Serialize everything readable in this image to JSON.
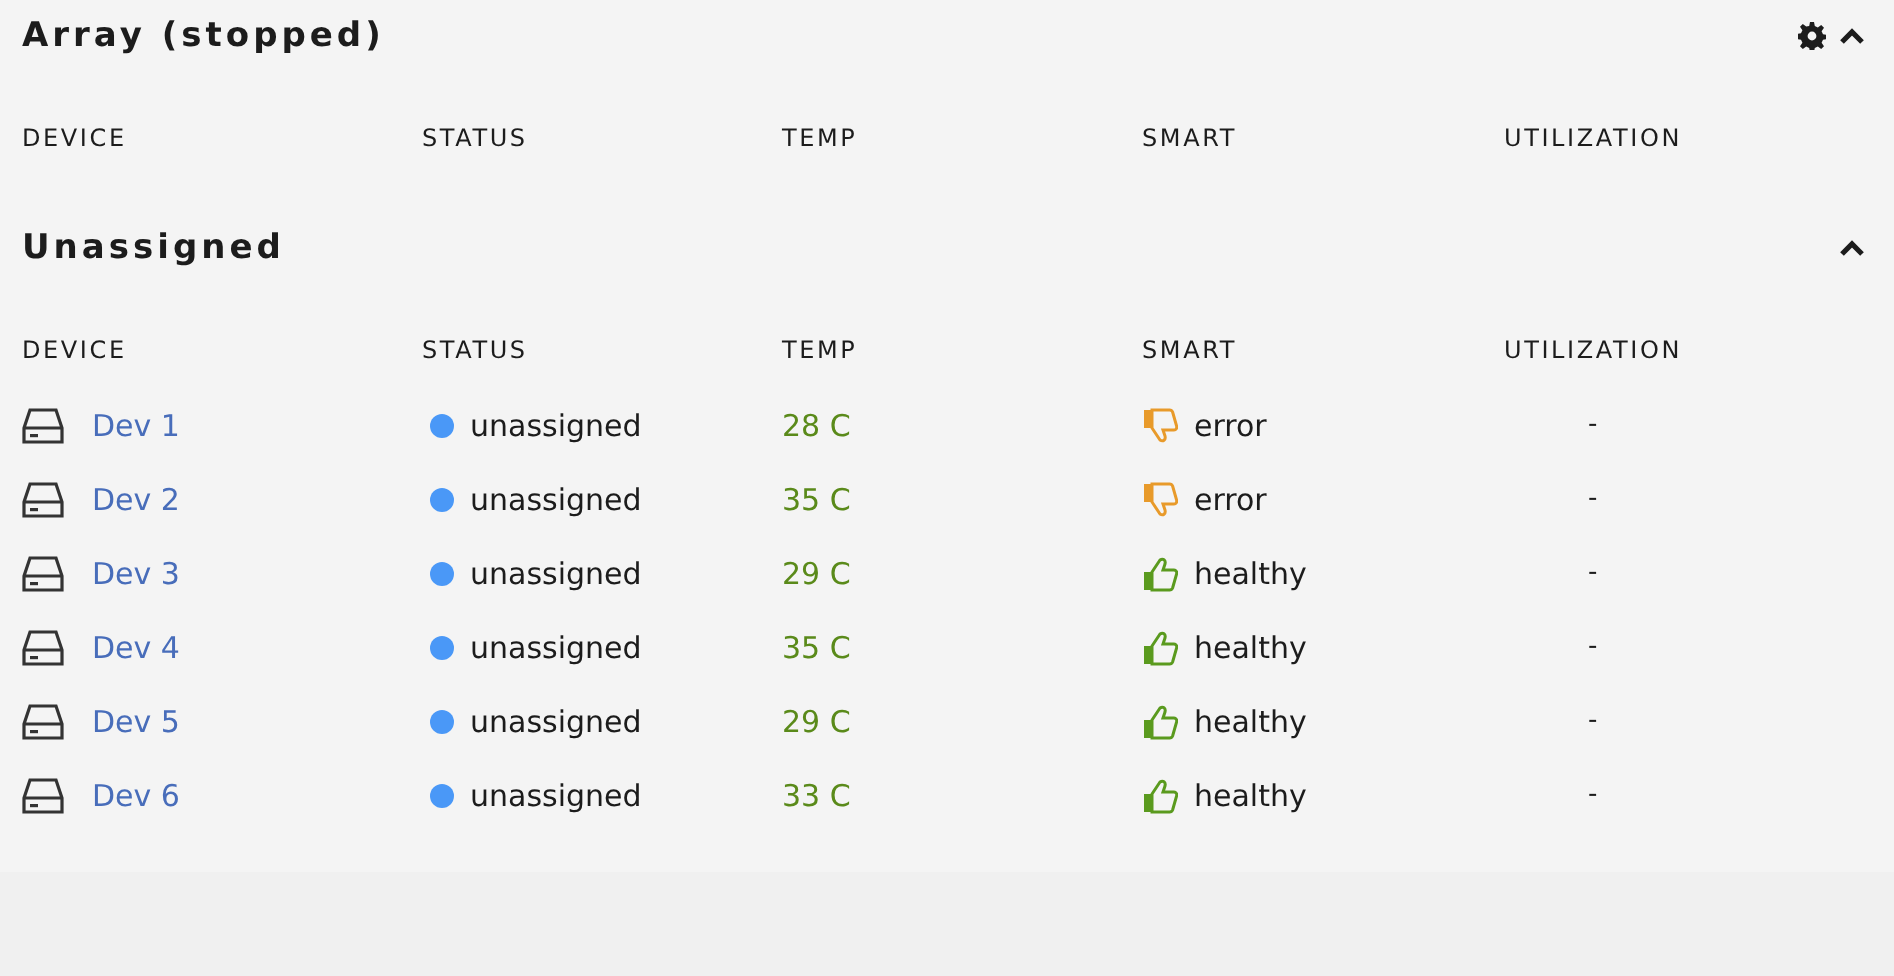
{
  "sections": [
    {
      "title": "Array (stopped)",
      "settings": true,
      "expanded": true,
      "columns": [
        "DEVICE",
        "STATUS",
        "TEMP",
        "SMART",
        "UTILIZATION"
      ]
    },
    {
      "title": "Unassigned",
      "settings": false,
      "expanded": true,
      "columns": [
        "DEVICE",
        "STATUS",
        "TEMP",
        "SMART",
        "UTILIZATION"
      ],
      "rows": [
        {
          "device": "Dev 1",
          "status": "unassigned",
          "color": "#4a98f7",
          "temp": "28 C",
          "smart": {
            "kind": "error",
            "label": "error"
          },
          "utilization": "-"
        },
        {
          "device": "Dev 2",
          "status": "unassigned",
          "color": "#4a98f7",
          "temp": "35 C",
          "smart": {
            "kind": "error",
            "label": "error"
          },
          "utilization": "-"
        },
        {
          "device": "Dev 3",
          "status": "unassigned",
          "color": "#4a98f7",
          "temp": "29 C",
          "smart": {
            "kind": "healthy",
            "label": "healthy"
          },
          "utilization": "-"
        },
        {
          "device": "Dev 4",
          "status": "unassigned",
          "color": "#4a98f7",
          "temp": "35 C",
          "smart": {
            "kind": "healthy",
            "label": "healthy"
          },
          "utilization": "-"
        },
        {
          "device": "Dev 5",
          "status": "unassigned",
          "color": "#4a98f7",
          "temp": "29 C",
          "smart": {
            "kind": "healthy",
            "label": "healthy"
          },
          "utilization": "-"
        },
        {
          "device": "Dev 6",
          "status": "unassigned",
          "color": "#4a98f7",
          "temp": "33 C",
          "smart": {
            "kind": "healthy",
            "label": "healthy"
          },
          "utilization": "-"
        }
      ]
    }
  ]
}
